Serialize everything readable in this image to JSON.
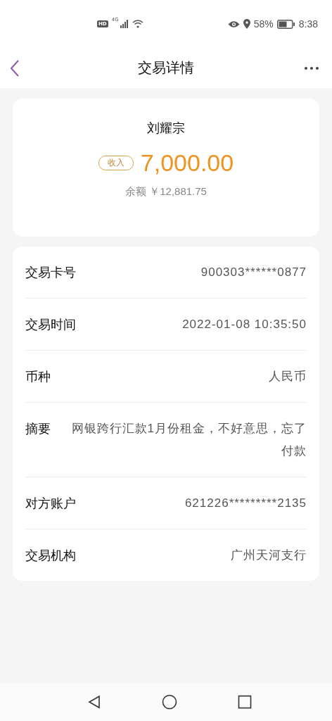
{
  "status_bar": {
    "hd_badge": "HD",
    "network": "4G",
    "battery_percent": "58%",
    "time": "8:38"
  },
  "header": {
    "title": "交易详情"
  },
  "summary": {
    "name": "刘耀宗",
    "direction_tag": "收入",
    "amount": "7,000.00",
    "balance": "余额 ￥12,881.75"
  },
  "details": [
    {
      "label": "交易卡号",
      "value": "900303******0877"
    },
    {
      "label": "交易时间",
      "value": "2022-01-08 10:35:50"
    },
    {
      "label": "币种",
      "value": "人民币"
    },
    {
      "label": "摘要",
      "value": "网银跨行汇款1月份租金，不好意思，忘了付款"
    },
    {
      "label": "对方账户",
      "value": "621226*********2135"
    },
    {
      "label": "交易机构",
      "value": "广州天河支行"
    }
  ]
}
